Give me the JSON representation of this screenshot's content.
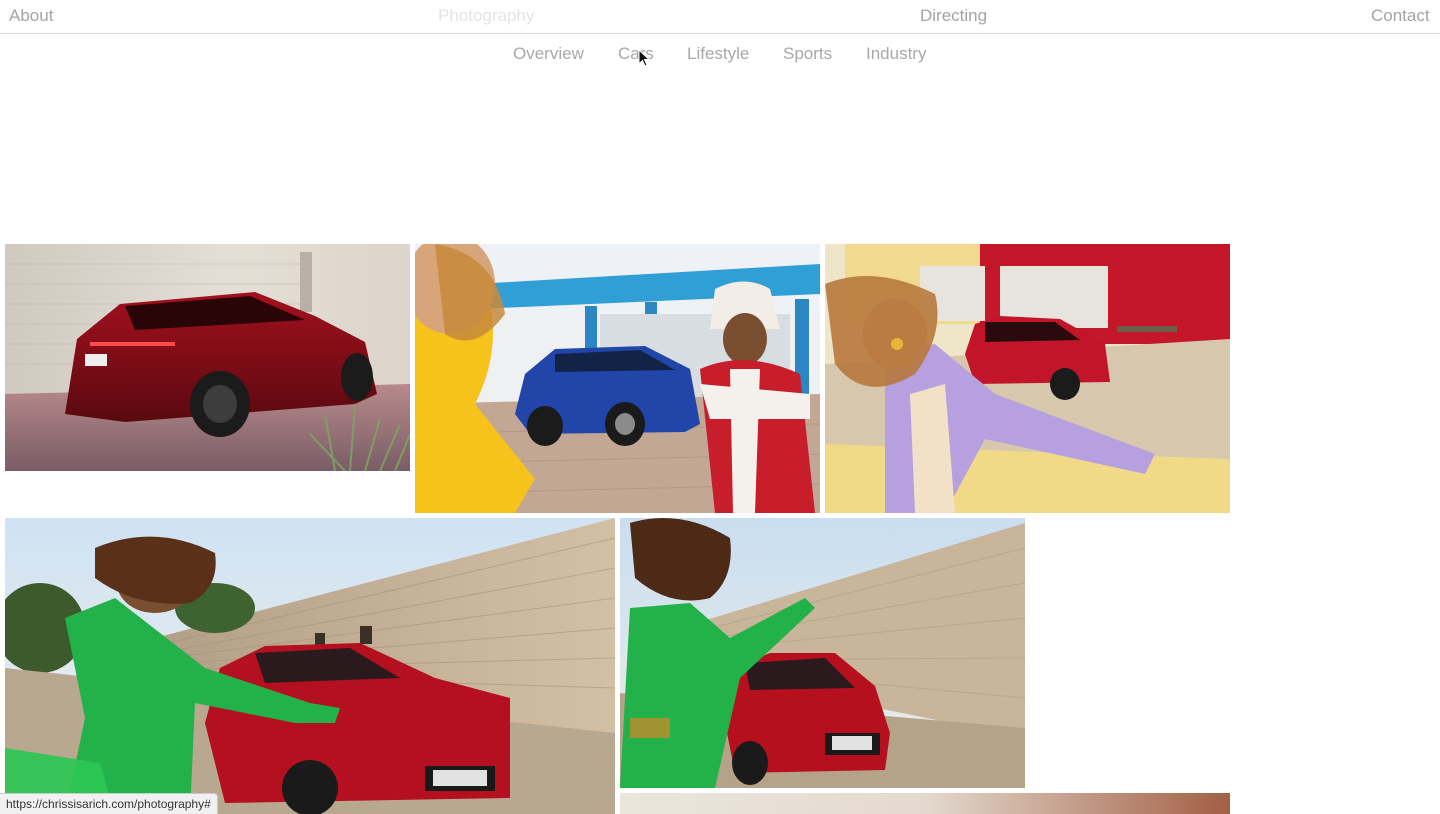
{
  "top_nav": {
    "about": "About",
    "photography": "Photography",
    "directing": "Directing",
    "contact": "Contact"
  },
  "sub_nav": {
    "items": [
      "Overview",
      "Cars",
      "Lifestyle",
      "Sports",
      "Industry"
    ]
  },
  "gallery": {
    "photos": [
      "Red electric SUV parked beside a white wall at dusk",
      "Woman in yellow and man in red jacket with blue compact SUV",
      "Woman in lilac suit with red SUV in a courtyard",
      "Woman in green dancing beside red crossover at a rammed-earth wall",
      "Woman in green posing with red crossover",
      "Partially visible photo"
    ]
  },
  "status_bar": {
    "url": "https://chrissisarich.com/photography#"
  },
  "colors": {
    "nav_text": "#a4a4a4",
    "nav_active": "#e4e4e4",
    "background": "#ffffff"
  }
}
